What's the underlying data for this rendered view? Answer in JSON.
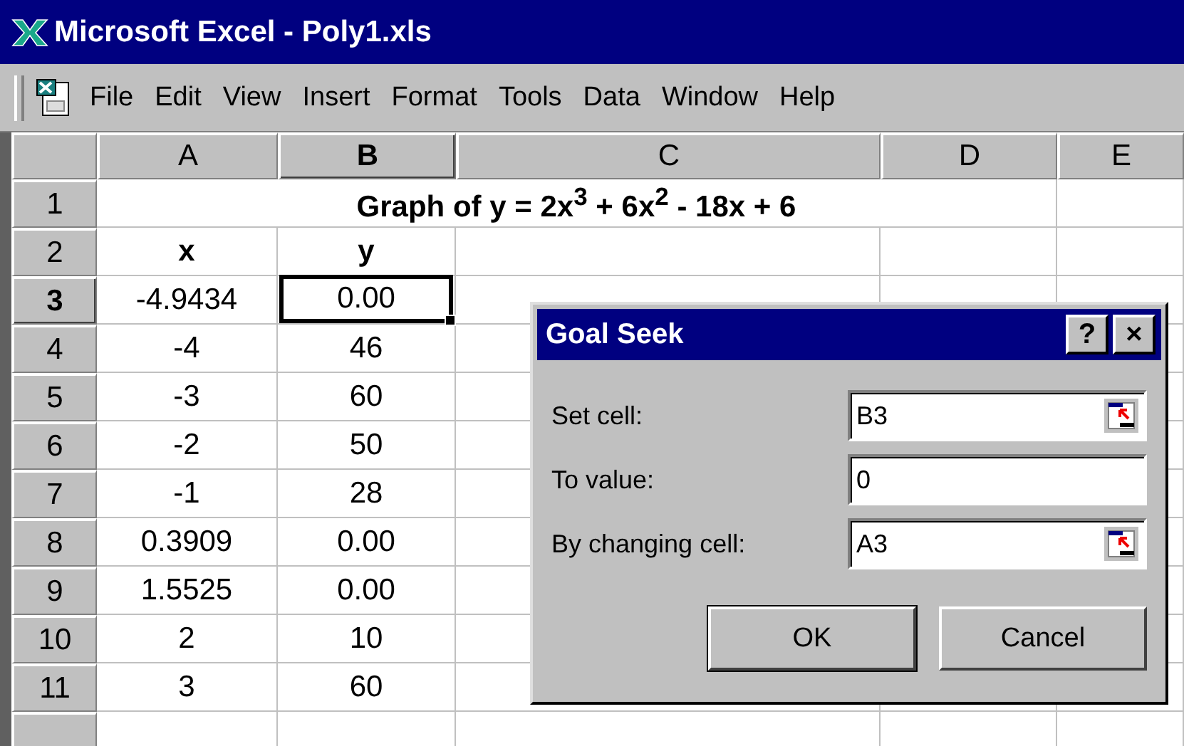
{
  "window": {
    "title": "Microsoft Excel - Poly1.xls"
  },
  "menu": [
    "File",
    "Edit",
    "View",
    "Insert",
    "Format",
    "Tools",
    "Data",
    "Window",
    "Help"
  ],
  "columns": [
    {
      "label": "A",
      "selected": false
    },
    {
      "label": "B",
      "selected": true
    },
    {
      "label": "C",
      "selected": false
    },
    {
      "label": "D",
      "selected": false
    },
    {
      "label": "E",
      "selected": false
    }
  ],
  "rows": [
    {
      "header": "1",
      "selected": false,
      "cells": [
        {
          "kind": "merged",
          "text": "Graph of y = 2x$^{3}$ +  6x$^{2}$ - 18x + 6"
        }
      ]
    },
    {
      "header": "2",
      "selected": false,
      "cells": [
        {
          "kind": "heading",
          "text": "x"
        },
        {
          "kind": "heading",
          "text": "y"
        }
      ]
    },
    {
      "header": "3",
      "selected": true,
      "cells": [
        {
          "kind": "value",
          "text": "-4.9434"
        },
        {
          "kind": "value",
          "text": "0.00",
          "active": true
        }
      ]
    },
    {
      "header": "4",
      "selected": false,
      "cells": [
        {
          "kind": "value",
          "text": "-4"
        },
        {
          "kind": "value",
          "text": "46"
        }
      ]
    },
    {
      "header": "5",
      "selected": false,
      "cells": [
        {
          "kind": "value",
          "text": "-3"
        },
        {
          "kind": "value",
          "text": "60"
        }
      ]
    },
    {
      "header": "6",
      "selected": false,
      "cells": [
        {
          "kind": "value",
          "text": "-2"
        },
        {
          "kind": "value",
          "text": "50"
        }
      ]
    },
    {
      "header": "7",
      "selected": false,
      "cells": [
        {
          "kind": "value",
          "text": "-1"
        },
        {
          "kind": "value",
          "text": "28"
        }
      ]
    },
    {
      "header": "8",
      "selected": false,
      "cells": [
        {
          "kind": "value",
          "text": "0.3909"
        },
        {
          "kind": "value",
          "text": "0.00"
        }
      ]
    },
    {
      "header": "9",
      "selected": false,
      "cells": [
        {
          "kind": "value",
          "text": "1.5525"
        },
        {
          "kind": "value",
          "text": "0.00"
        }
      ]
    },
    {
      "header": "10",
      "selected": false,
      "cells": [
        {
          "kind": "value",
          "text": "2"
        },
        {
          "kind": "value",
          "text": "10"
        }
      ]
    },
    {
      "header": "11",
      "selected": false,
      "cells": [
        {
          "kind": "value",
          "text": "3"
        },
        {
          "kind": "value",
          "text": "60"
        }
      ]
    }
  ],
  "dialog": {
    "title": "Goal Seek",
    "help": "?",
    "close": "×",
    "fields": [
      {
        "label": "Set cell:",
        "value": "B3",
        "kind": "reference"
      },
      {
        "label": "To value:",
        "value": "0",
        "kind": "plain"
      },
      {
        "label": "By changing cell:",
        "value": "A3",
        "kind": "reference"
      }
    ],
    "buttons": [
      "OK",
      "Cancel"
    ]
  }
}
